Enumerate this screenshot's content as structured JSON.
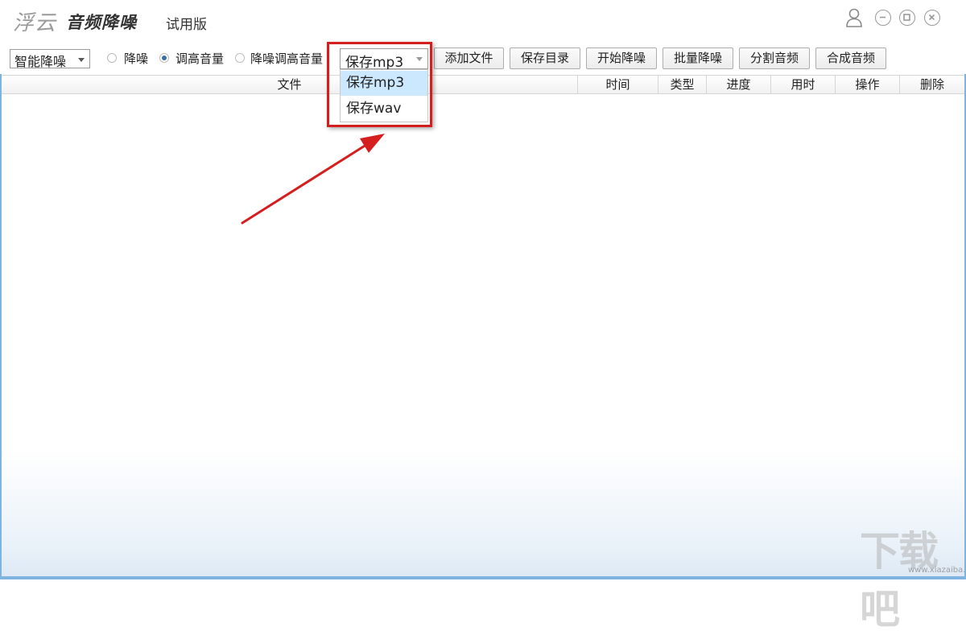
{
  "titlebar": {
    "brand": "浮云",
    "product": "音频降噪",
    "edition": "试用版",
    "icons": [
      "user-icon",
      "minimize-icon",
      "maximize-icon",
      "close-icon"
    ]
  },
  "toolbar": {
    "mode_select": {
      "value": "智能降噪"
    },
    "radios": [
      {
        "label": "降噪",
        "checked": false
      },
      {
        "label": "调高音量",
        "checked": true
      },
      {
        "label": "降噪调高音量",
        "checked": false
      }
    ],
    "format_select": {
      "value": "保存mp3",
      "options": [
        "保存mp3",
        "保存wav"
      ]
    },
    "buttons": {
      "add_file": "添加文件",
      "save_dir": "保存目录",
      "start": "开始降噪",
      "batch": "批量降噪",
      "split": "分割音频",
      "merge": "合成音频"
    }
  },
  "table": {
    "columns": [
      "文件",
      "时间",
      "类型",
      "进度",
      "用时",
      "操作",
      "删除"
    ],
    "rows": []
  },
  "watermark": {
    "logo": "下载吧",
    "url": "www.xiazaiba.com"
  },
  "colors": {
    "highlight_box": "#d51f1f",
    "selected_option": "#cce8ff",
    "frame": "#7fb3e0",
    "radio_dot": "#3a6ea5"
  }
}
